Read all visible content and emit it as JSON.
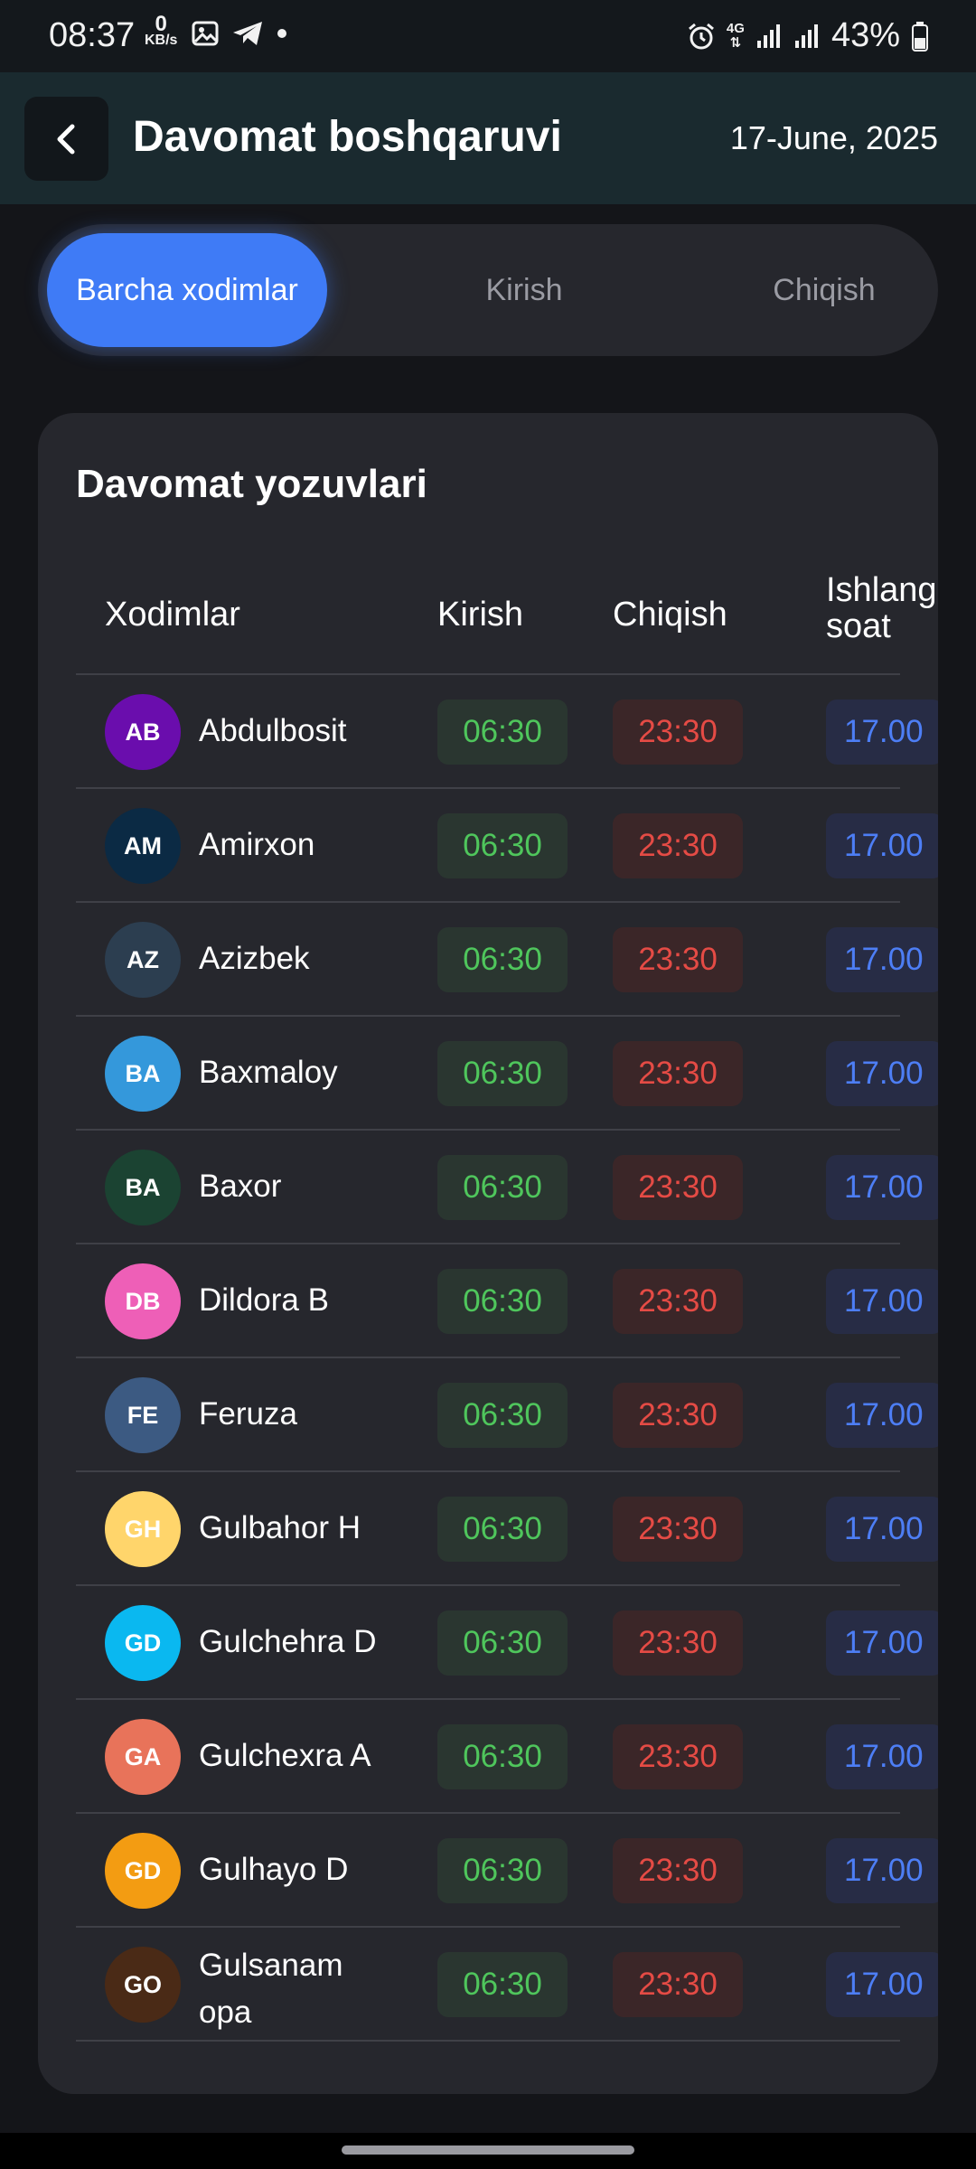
{
  "status_bar": {
    "time": "08:37",
    "net_speed_value": "0",
    "net_speed_unit": "KB/s",
    "network": "4G",
    "battery": "43%",
    "icons": [
      "gallery-icon",
      "telegram-icon",
      "dot-icon",
      "alarm-icon",
      "data-arrows-icon",
      "signal-icon",
      "signal-icon",
      "battery-icon"
    ]
  },
  "app_bar": {
    "title": "Davomat boshqaruvi",
    "date": "17-June, 2025"
  },
  "tabs": [
    {
      "label": "Barcha xodimlar",
      "active": true
    },
    {
      "label": "Kirish",
      "active": false
    },
    {
      "label": "Chiqish",
      "active": false
    }
  ],
  "card": {
    "title": "Davomat yozuvlari",
    "columns": {
      "name": "Xodimlar",
      "check_in": "Kirish",
      "check_out": "Chiqish",
      "hours": "Ishlangan soat"
    },
    "rows": [
      {
        "initials": "AB",
        "avatar_color": "#6a0dad",
        "name": "Abdulbosit",
        "in": "06:30",
        "out": "23:30",
        "hours": "17.00"
      },
      {
        "initials": "AM",
        "avatar_color": "#0b2a44",
        "name": "Amirxon",
        "in": "06:30",
        "out": "23:30",
        "hours": "17.00"
      },
      {
        "initials": "AZ",
        "avatar_color": "#2c3e50",
        "name": "Azizbek",
        "in": "06:30",
        "out": "23:30",
        "hours": "17.00"
      },
      {
        "initials": "BA",
        "avatar_color": "#3498db",
        "name": "Baxmaloy",
        "in": "06:30",
        "out": "23:30",
        "hours": "17.00"
      },
      {
        "initials": "BA",
        "avatar_color": "#1b4332",
        "name": "Baxor",
        "in": "06:30",
        "out": "23:30",
        "hours": "17.00"
      },
      {
        "initials": "DB",
        "avatar_color": "#ee5fb7",
        "name": "Dildora B",
        "in": "06:30",
        "out": "23:30",
        "hours": "17.00"
      },
      {
        "initials": "FE",
        "avatar_color": "#3c5a82",
        "name": "Feruza",
        "in": "06:30",
        "out": "23:30",
        "hours": "17.00"
      },
      {
        "initials": "GH",
        "avatar_color": "#ffd56b",
        "name": "Gulbahor H",
        "in": "06:30",
        "out": "23:30",
        "hours": "17.00"
      },
      {
        "initials": "GD",
        "avatar_color": "#0ab8f0",
        "name": "Gulchehra D",
        "in": "06:30",
        "out": "23:30",
        "hours": "17.00"
      },
      {
        "initials": "GA",
        "avatar_color": "#e8735a",
        "name": "Gulchexra A",
        "in": "06:30",
        "out": "23:30",
        "hours": "17.00"
      },
      {
        "initials": "GD",
        "avatar_color": "#f39c12",
        "name": "Gulhayo D",
        "in": "06:30",
        "out": "23:30",
        "hours": "17.00"
      },
      {
        "initials": "GO",
        "avatar_color": "#4a2a16",
        "name": "Gulsanam opa",
        "in": "06:30",
        "out": "23:30",
        "hours": "17.00"
      }
    ]
  },
  "colors": {
    "accent": "#3f7bf6",
    "check_in": "#4fc65c",
    "check_out": "#e54b45",
    "hours": "#4d7ef5"
  }
}
